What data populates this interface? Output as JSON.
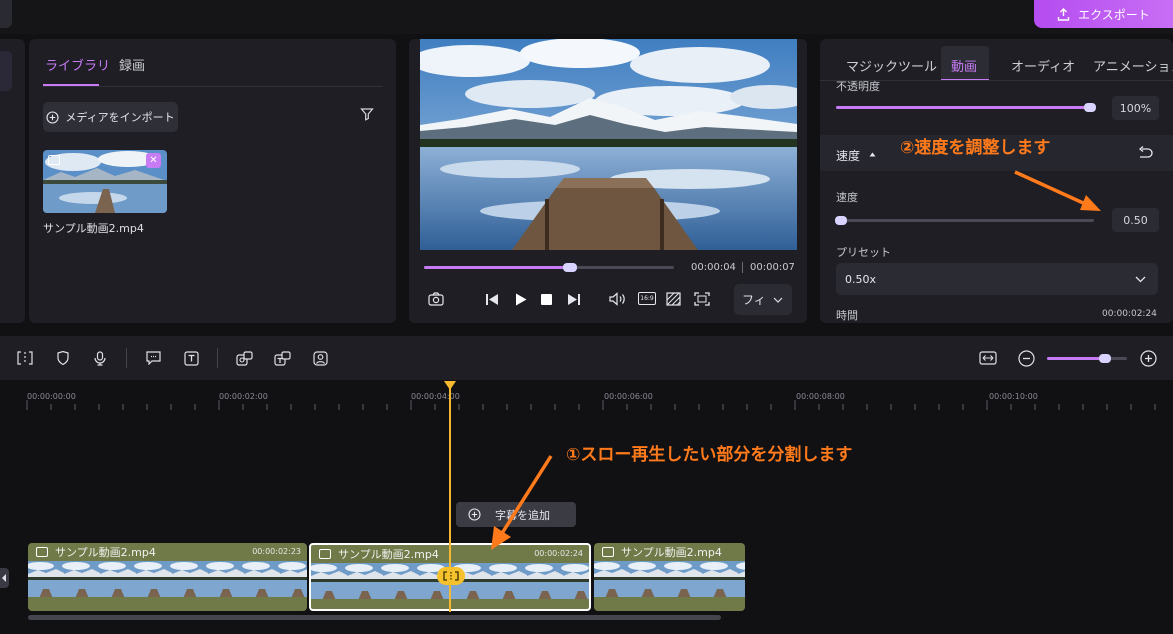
{
  "header": {
    "export_label": "エクスポート"
  },
  "library": {
    "tabs": [
      {
        "label": "ライブラリ"
      },
      {
        "label": "録画"
      }
    ],
    "import_label": "メディアをインポート",
    "media": [
      {
        "name": "サンプル動画2.mp4"
      }
    ]
  },
  "player": {
    "current_time": "00:00:04",
    "total_time": "00:00:07",
    "progress": 0.58,
    "fit_label": "フィ"
  },
  "properties": {
    "tabs": [
      {
        "label": "マジックツール"
      },
      {
        "label": "動画"
      },
      {
        "label": "オーディオ"
      },
      {
        "label": "アニメーション"
      }
    ],
    "opacity_label": "不透明度",
    "opacity_value": "100%",
    "opacity_level": 1.0,
    "speed_section_label": "速度",
    "speed_label": "速度",
    "speed_value": "0.50",
    "speed_level": 0.02,
    "preset_label": "プリセット",
    "preset_value": "0.50x",
    "duration_label": "時間",
    "duration_value": "00:00:02:24"
  },
  "timeline": {
    "zoom_level": 0.72,
    "ruler": [
      "00:00:00:00",
      "00:00:02:00",
      "00:00:04:00",
      "00:00:06:00",
      "00:00:08:00",
      "00:00:10:00"
    ],
    "add_caption_label": "字幕を追加",
    "clips": [
      {
        "name": "サンプル動画2.mp4",
        "duration": "00:00:02:23"
      },
      {
        "name": "サンプル動画2.mp4",
        "duration": "00:00:02:24"
      },
      {
        "name": "サンプル動画2.mp4",
        "duration": ""
      }
    ]
  },
  "annotations": {
    "speed_note": "②速度を調整します",
    "split_note": "①スロー再生したい部分を分割します"
  },
  "colors": {
    "accent": "#c77bf5",
    "annotation": "#ff7a1a",
    "clip": "#6f7a48",
    "playhead": "#f5b82e"
  }
}
